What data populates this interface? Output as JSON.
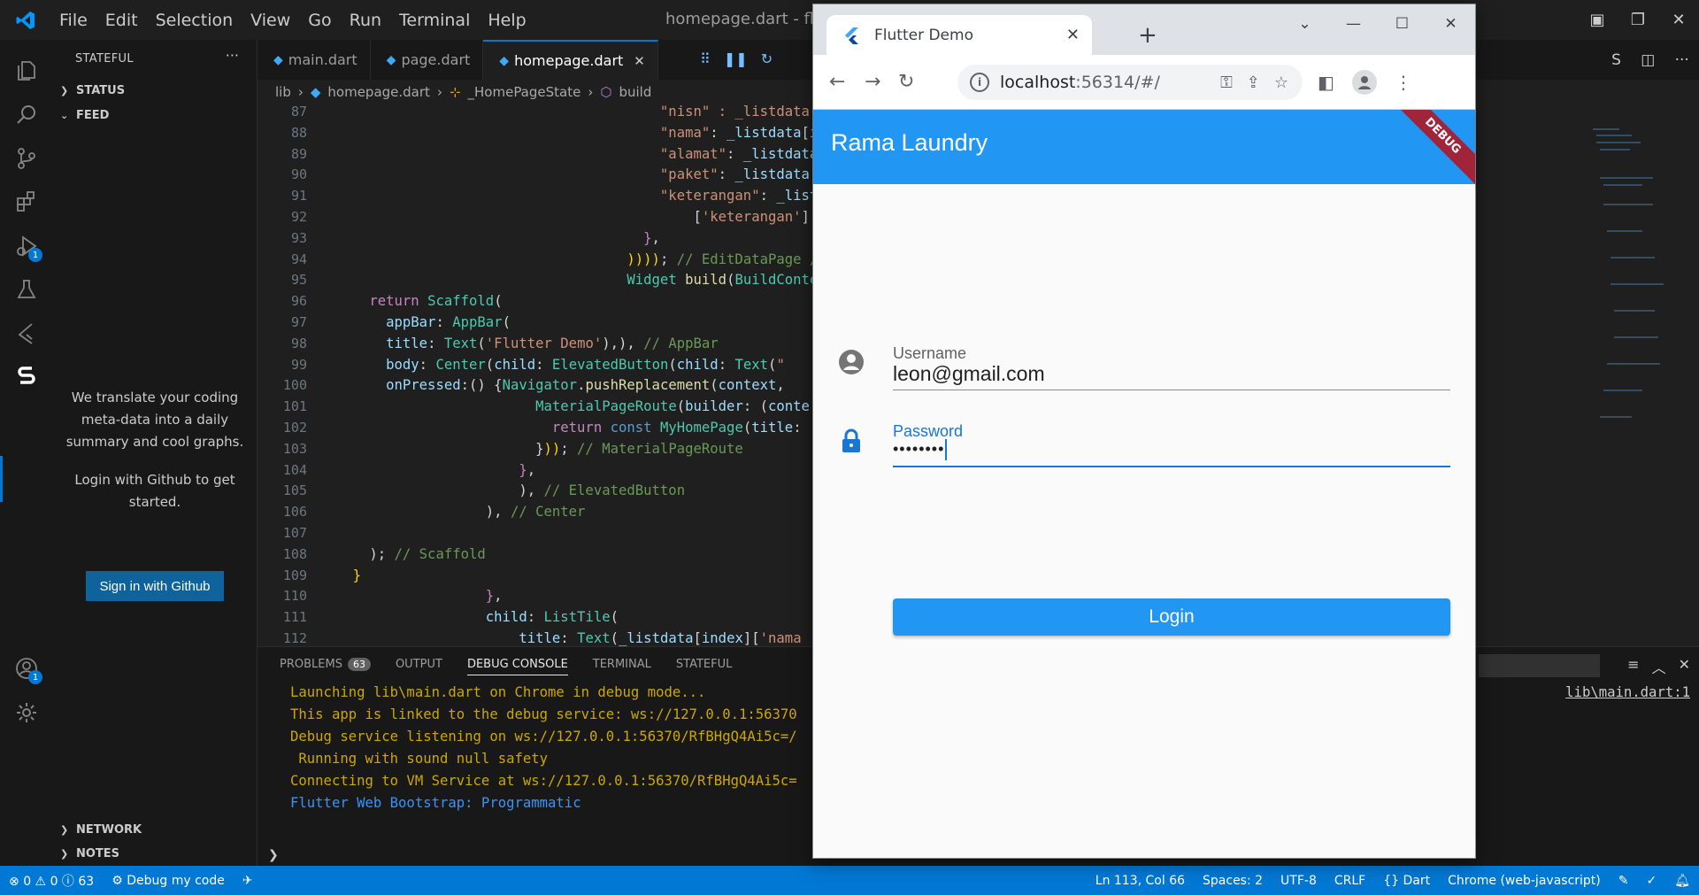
{
  "vscode": {
    "menu": [
      "File",
      "Edit",
      "Selection",
      "View",
      "Go",
      "Run",
      "Terminal",
      "Help"
    ],
    "title": "homepage.dart - flut",
    "sidebar": {
      "title": "STATEFUL",
      "sections": {
        "status": "STATUS",
        "feed": "FEED",
        "network": "NETWORK",
        "notes": "NOTES"
      },
      "message1": "We translate your coding meta-data into a daily summary and cool graphs.",
      "message2": "Login with Github to get started.",
      "signin": "Sign in with Github"
    },
    "badges": {
      "debug": "1",
      "accounts": "1"
    },
    "tabs": [
      "main.dart",
      "page.dart",
      "homepage.dart"
    ],
    "breadcrumb": [
      "lib",
      "homepage.dart",
      "_HomePageState",
      "build"
    ],
    "line_numbers": [
      "87",
      "88",
      "89",
      "90",
      "91",
      "92",
      "93",
      "94",
      "95",
      "96",
      "97",
      "98",
      "99",
      "100",
      "101",
      "102",
      "103",
      "104",
      "105",
      "106",
      "107",
      "108",
      "109",
      "110",
      "111",
      "112"
    ],
    "panel": {
      "tabs": [
        "PROBLEMS",
        "OUTPUT",
        "DEBUG CONSOLE",
        "TERMINAL",
        "STATEFUL"
      ],
      "problems_count": "63",
      "console": [
        "Launching lib\\main.dart on Chrome in debug mode...",
        "This app is linked to the debug service: ws://127.0.0.1:56370",
        "Debug service listening on ws://127.0.0.1:56370/RfBHgQ4Ai5c=/",
        " Running with sound null safety",
        "Connecting to VM Service at ws://127.0.0.1:56370/RfBHgQ4Ai5c=",
        "Flutter Web Bootstrap: Programmatic"
      ],
      "link": "lib\\main.dart:1"
    },
    "status": {
      "errors": "0",
      "warnings": "0",
      "info": "63",
      "debug": "Debug my code",
      "position": "Ln 113, Col 66",
      "spaces": "Spaces: 2",
      "encoding": "UTF-8",
      "eol": "CRLF",
      "language": "Dart",
      "device": "Chrome (web-javascript)"
    }
  },
  "chrome": {
    "tab_title": "Flutter Demo",
    "url_host": "localhost",
    "url_rest": ":56314/#/"
  },
  "app": {
    "title": "Rama Laundry",
    "debug_banner": "DEBUG",
    "username_label": "Username",
    "username_value": "leon@gmail.com",
    "password_label": "Password",
    "password_value": "••••••••",
    "login": "Login",
    "colors": {
      "primary": "#2196f3",
      "focus": "#1976d2"
    }
  }
}
